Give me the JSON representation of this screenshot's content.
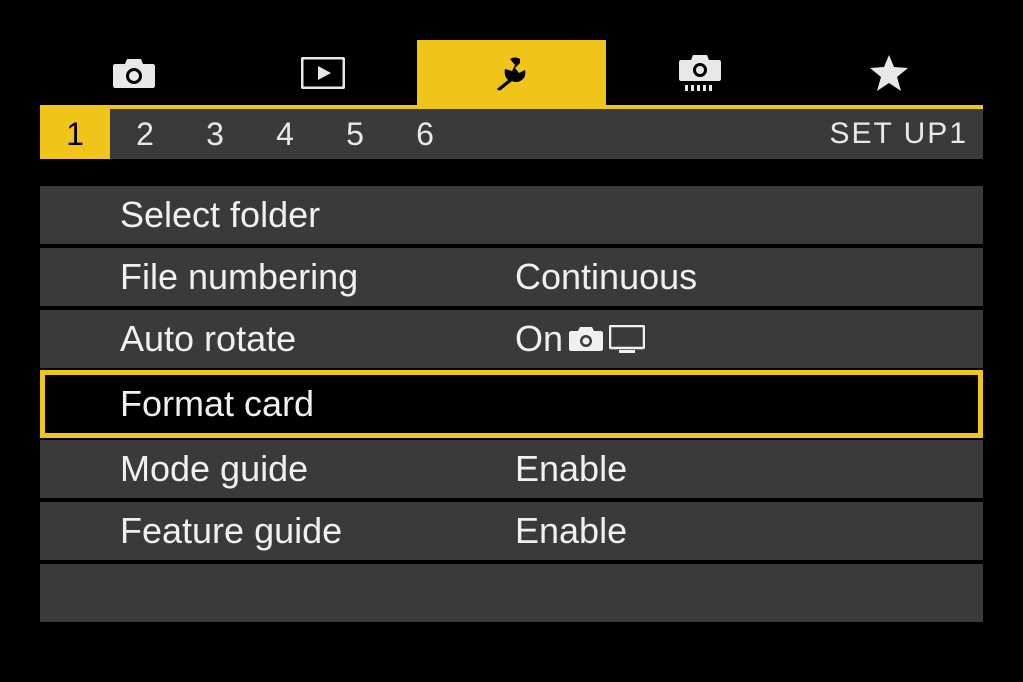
{
  "tabs": {
    "icons": [
      "camera",
      "playback",
      "wrench",
      "camera-level",
      "star"
    ],
    "activeIndex": 2
  },
  "pages": {
    "numbers": [
      "1",
      "2",
      "3",
      "4",
      "5",
      "6"
    ],
    "activeIndex": 0,
    "label": "SET UP1"
  },
  "menu": {
    "items": [
      {
        "label": "Select folder",
        "value": "",
        "selected": false
      },
      {
        "label": "File numbering",
        "value": "Continuous",
        "selected": false
      },
      {
        "label": "Auto rotate",
        "value": "On",
        "selected": false,
        "valueIcons": [
          "camera",
          "monitor"
        ]
      },
      {
        "label": "Format card",
        "value": "",
        "selected": true
      },
      {
        "label": "Mode guide",
        "value": "Enable",
        "selected": false
      },
      {
        "label": "Feature guide",
        "value": "Enable",
        "selected": false
      }
    ]
  },
  "colors": {
    "accent": "#f0c418",
    "panel": "#3a3a3a",
    "text": "#f0f0f0",
    "bg": "#000000"
  }
}
